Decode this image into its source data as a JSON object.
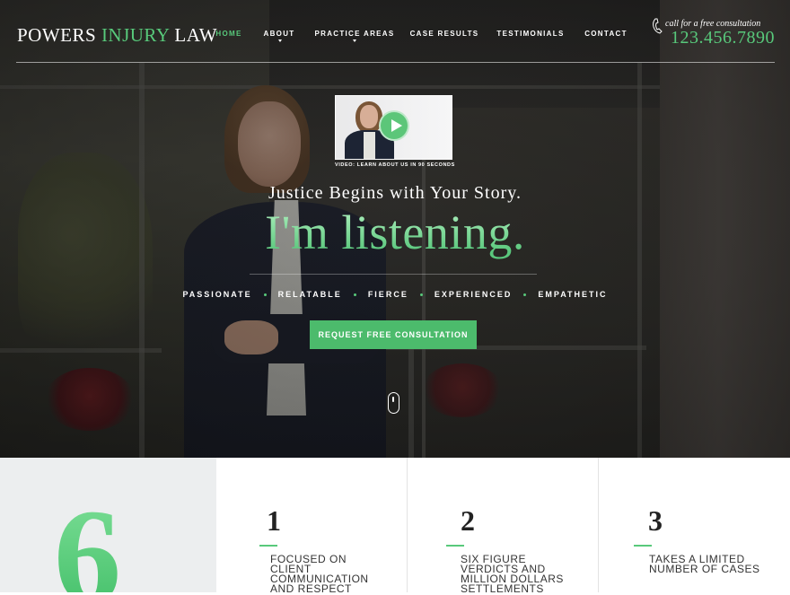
{
  "brand": {
    "name_part1": "POWERS ",
    "name_part2": "INJURY",
    "name_part3": " LAW",
    "accent_color": "#58c97b"
  },
  "nav": {
    "items": [
      {
        "label": "HOME",
        "active": true
      },
      {
        "label": "ABOUT",
        "has_dropdown": true
      },
      {
        "label": "PRACTICE AREAS",
        "has_dropdown": true
      },
      {
        "label": "CASE RESULTS"
      },
      {
        "label": "TESTIMONIALS"
      },
      {
        "label": "CONTACT"
      }
    ]
  },
  "contact": {
    "label": "call for a free consultation",
    "phone": "123.456.7890",
    "icon": "phone-icon"
  },
  "hero": {
    "video_caption": "VIDEO: LEARN ABOUT US IN 90 SECONDS",
    "tagline": "Justice Begins with Your Story.",
    "headline": "I'm listening.",
    "traits": [
      "PASSIONATE",
      "RELATABLE",
      "FIERCE",
      "EXPERIENCED",
      "EMPATHETIC"
    ],
    "cta_label": "REQUEST FREE CONSULTATION"
  },
  "features": {
    "big_number": "6",
    "columns": [
      {
        "number": "1",
        "text": "FOCUSED ON CLIENT COMMUNICATION AND RESPECT"
      },
      {
        "number": "2",
        "text": "SIX FIGURE VERDICTS AND MILLION DOLLARS SETTLEMENTS"
      },
      {
        "number": "3",
        "text": "TAKES A LIMITED NUMBER OF CASES"
      }
    ]
  }
}
